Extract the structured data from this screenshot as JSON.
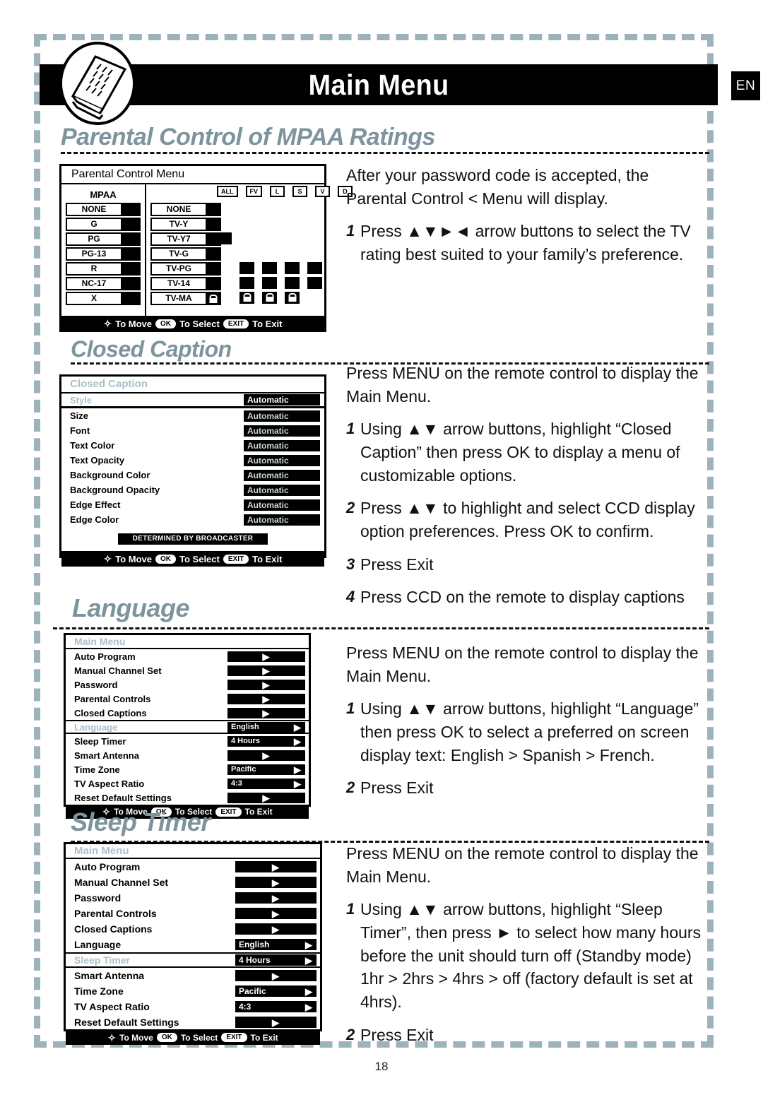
{
  "header": {
    "title": "Main Menu",
    "language_badge": "EN",
    "book_icon": "open-book-icon"
  },
  "page_number": "18",
  "osd_footer": {
    "dpad_icon": "four-way-arrow-icon",
    "move_label": "To Move",
    "ok_pill": "OK",
    "select_label": "To Select",
    "exit_pill": "EXIT",
    "exit_label": "To Exit"
  },
  "sections": [
    {
      "heading": "Parental Control of MPAA Ratings",
      "panel": {
        "title": "Parental Control Menu",
        "left_column_label": "MPAA",
        "mpaa_ratings": [
          "NONE",
          "G",
          "PG",
          "PG-13",
          "R",
          "NC-17",
          "X"
        ],
        "flag_headers": [
          "ALL",
          "FV",
          "L",
          "S",
          "V",
          "D"
        ],
        "tv_ratings": [
          {
            "name": "NONE",
            "box": "filled",
            "flags": [
              "",
              "",
              "",
              "",
              ""
            ]
          },
          {
            "name": "TV-Y",
            "box": "filled",
            "flags": [
              "",
              "",
              "",
              "",
              ""
            ]
          },
          {
            "name": "TV-Y7",
            "box": "filled",
            "flags": [
              "filled",
              "",
              "",
              "",
              ""
            ]
          },
          {
            "name": "TV-G",
            "box": "filled",
            "flags": [
              "",
              "",
              "",
              "",
              ""
            ]
          },
          {
            "name": "TV-PG",
            "box": "filled",
            "flags": [
              "",
              "filled",
              "filled",
              "filled",
              "filled"
            ]
          },
          {
            "name": "TV-14",
            "box": "filled",
            "flags": [
              "",
              "filled",
              "filled",
              "filled",
              "filled"
            ]
          },
          {
            "name": "TV-MA",
            "box": "lock",
            "flags": [
              "",
              "lock",
              "lock",
              "lock",
              ""
            ]
          }
        ]
      },
      "instructions": {
        "intro": "After your password code is accepted, the Parental Control < Menu will display.",
        "steps": [
          {
            "num": "1",
            "text": "Press ▲▼►◄ arrow buttons to select the TV rating best suited to your family’s preference."
          }
        ]
      }
    },
    {
      "heading": "Closed Caption",
      "panel": {
        "title": "Closed Caption",
        "rows": [
          {
            "label": "Style",
            "value": "Automatic",
            "highlighted": true
          },
          {
            "label": "Size",
            "value": "Automatic",
            "highlighted": false
          },
          {
            "label": "Font",
            "value": "Automatic",
            "highlighted": false
          },
          {
            "label": "Text Color",
            "value": "Automatic",
            "highlighted": false
          },
          {
            "label": "Text Opacity",
            "value": "Automatic",
            "highlighted": false
          },
          {
            "label": "Background Color",
            "value": "Automatic",
            "highlighted": false
          },
          {
            "label": "Background Opacity",
            "value": "Automatic",
            "highlighted": false
          },
          {
            "label": "Edge Effect",
            "value": "Automatic",
            "highlighted": false
          },
          {
            "label": "Edge Color",
            "value": "Automatic",
            "highlighted": false
          }
        ],
        "broadcast_note": "DETERMINED BY BROADCASTER"
      },
      "instructions": {
        "intro": "Press MENU on the remote control to display the Main Menu.",
        "steps": [
          {
            "num": "1",
            "text": "Using ▲▼ arrow buttons, highlight “Closed Caption” then press OK to display a menu of customizable options."
          },
          {
            "num": "2",
            "text": "Press ▲▼  to highlight and select CCD display option preferences. Press OK to confirm."
          },
          {
            "num": "3",
            "text": "Press Exit"
          },
          {
            "num": "4",
            "text": "Press CCD on the remote to display captions"
          }
        ]
      }
    },
    {
      "heading": "Language",
      "panel": {
        "title": "Main Menu",
        "rows": [
          {
            "label": "Auto Program",
            "value": "",
            "highlighted": false
          },
          {
            "label": "Manual Channel Set",
            "value": "",
            "highlighted": false
          },
          {
            "label": "Password",
            "value": "",
            "highlighted": false
          },
          {
            "label": "Parental Controls",
            "value": "",
            "highlighted": false
          },
          {
            "label": "Closed Captions",
            "value": "",
            "highlighted": false
          },
          {
            "label": "Language",
            "value": "English",
            "highlighted": true
          },
          {
            "label": "Sleep Timer",
            "value": "4 Hours",
            "highlighted": false
          },
          {
            "label": "Smart Antenna",
            "value": "",
            "highlighted": false
          },
          {
            "label": "Time Zone",
            "value": "Pacific",
            "highlighted": false
          },
          {
            "label": "TV Aspect Ratio",
            "value": "4:3",
            "highlighted": false
          },
          {
            "label": "Reset Default Settings",
            "value": "",
            "highlighted": false
          }
        ]
      },
      "instructions": {
        "intro": "Press MENU on the remote control to display the Main Menu.",
        "steps": [
          {
            "num": "1",
            "text": "Using ▲▼ arrow buttons, highlight “Language”  then press OK to select a preferred on screen display text: English > Spanish > French."
          },
          {
            "num": "2",
            "text": "Press Exit"
          }
        ]
      }
    },
    {
      "heading": "Sleep Timer",
      "panel": {
        "title": "Main Menu",
        "rows": [
          {
            "label": "Auto Program",
            "value": "",
            "highlighted": false
          },
          {
            "label": "Manual Channel Set",
            "value": "",
            "highlighted": false
          },
          {
            "label": "Password",
            "value": "",
            "highlighted": false
          },
          {
            "label": "Parental Controls",
            "value": "",
            "highlighted": false
          },
          {
            "label": "Closed Captions",
            "value": "",
            "highlighted": false
          },
          {
            "label": "Language",
            "value": "English",
            "highlighted": false
          },
          {
            "label": "Sleep Timer",
            "value": "4 Hours",
            "highlighted": true
          },
          {
            "label": "Smart Antenna",
            "value": "",
            "highlighted": false
          },
          {
            "label": "Time Zone",
            "value": "Pacific",
            "highlighted": false
          },
          {
            "label": "TV Aspect Ratio",
            "value": "4:3",
            "highlighted": false
          },
          {
            "label": "Reset Default Settings",
            "value": "",
            "highlighted": false
          }
        ]
      },
      "instructions": {
        "intro": "Press MENU on the remote control to display the Main Menu.",
        "steps": [
          {
            "num": "1",
            "text": "Using ▲▼ arrow buttons, highlight “Sleep Timer”, then press ► to select how many hours before the unit should turn off (Standby mode) 1hr > 2hrs > 4hrs > off (factory default is set at 4hrs)."
          },
          {
            "num": "2",
            "text": "Press Exit"
          }
        ]
      }
    }
  ]
}
